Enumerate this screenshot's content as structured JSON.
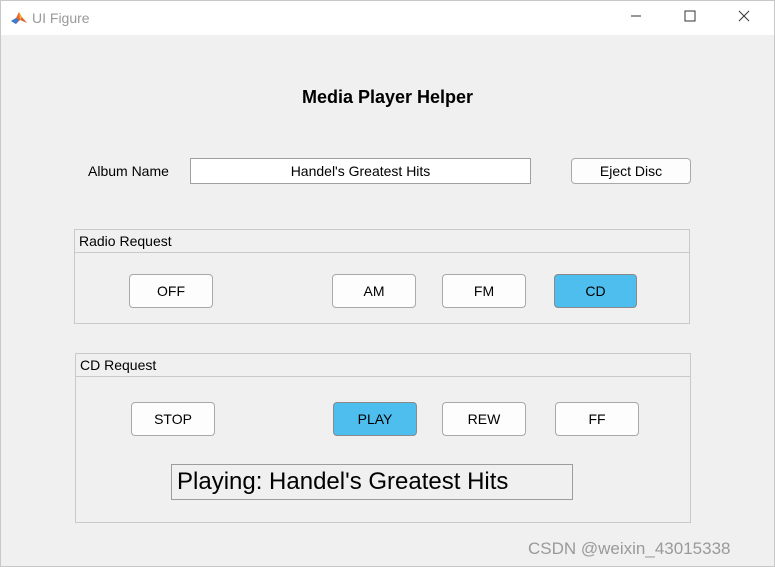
{
  "window": {
    "title": "UI Figure"
  },
  "figure": {
    "heading": "Media Player Helper"
  },
  "album": {
    "label": "Album Name",
    "value": "Handel's Greatest Hits",
    "eject_label": "Eject Disc"
  },
  "radio_panel": {
    "title": "Radio Request",
    "buttons": [
      {
        "label": "OFF",
        "active": false
      },
      {
        "label": "AM",
        "active": false
      },
      {
        "label": "FM",
        "active": false
      },
      {
        "label": "CD",
        "active": true
      }
    ]
  },
  "cd_panel": {
    "title": "CD Request",
    "buttons": [
      {
        "label": "STOP",
        "active": false
      },
      {
        "label": "PLAY",
        "active": true
      },
      {
        "label": "REW",
        "active": false
      },
      {
        "label": "FF",
        "active": false
      }
    ],
    "status": "Playing: Handel's Greatest Hits"
  },
  "watermark": "CSDN @weixin_43015338",
  "colors": {
    "active_button": "#4dbeee",
    "background": "#f0f0f0"
  },
  "icons": {
    "app": "matlab-icon",
    "minimize": "minimize-icon",
    "maximize": "maximize-icon",
    "close": "close-icon"
  }
}
